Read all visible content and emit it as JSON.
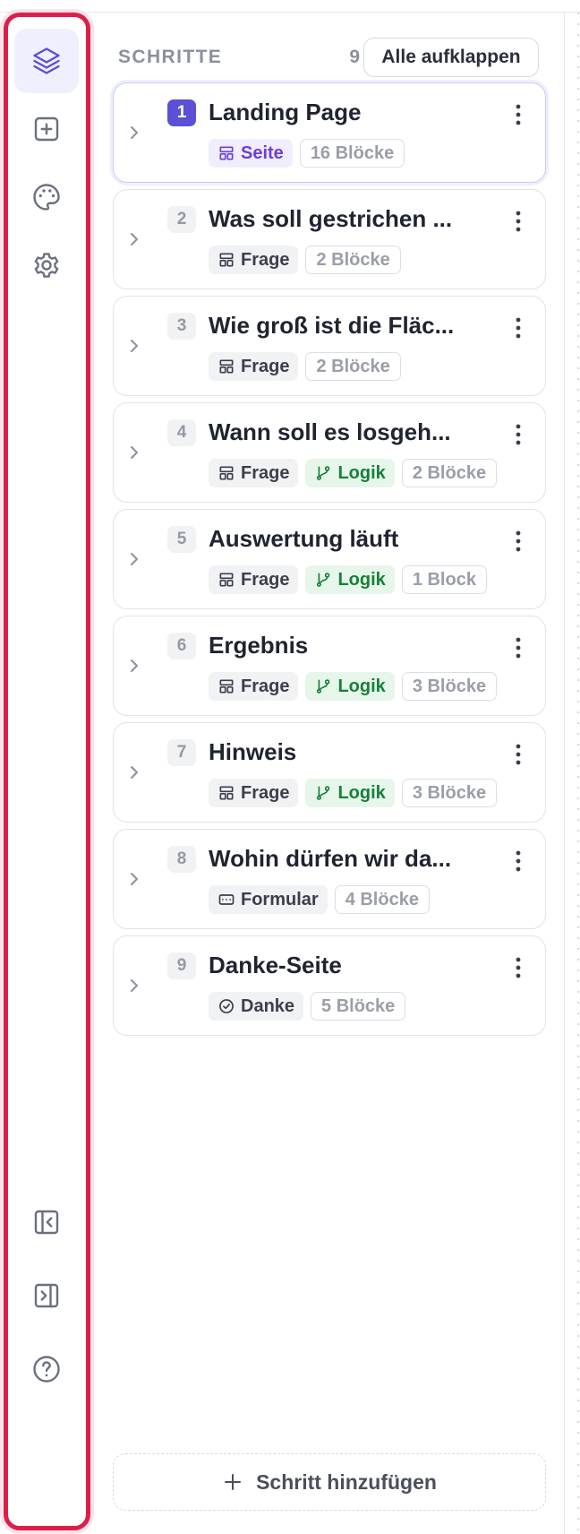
{
  "header": {
    "title": "SCHRITTE",
    "count": "9",
    "expand_all": "Alle aufklappen"
  },
  "rail": {
    "top": [
      {
        "icon": "layers-icon",
        "active": true
      },
      {
        "icon": "add-square-icon",
        "active": false
      },
      {
        "icon": "palette-icon",
        "active": false
      },
      {
        "icon": "gear-icon",
        "active": false
      }
    ],
    "bottom": [
      {
        "icon": "collapse-left-panel-icon"
      },
      {
        "icon": "expand-right-panel-icon"
      },
      {
        "icon": "help-icon"
      }
    ]
  },
  "steps": [
    {
      "num": "1",
      "title": "Landing Page",
      "type": "Seite",
      "type_icon": "layout-icon",
      "logic": null,
      "blocks": "16 Blöcke",
      "selected": true
    },
    {
      "num": "2",
      "title": "Was soll gestrichen ...",
      "type": "Frage",
      "type_icon": "layout-icon",
      "logic": null,
      "blocks": "2 Blöcke",
      "selected": false
    },
    {
      "num": "3",
      "title": "Wie groß ist die Fläc...",
      "type": "Frage",
      "type_icon": "layout-icon",
      "logic": null,
      "blocks": "2 Blöcke",
      "selected": false
    },
    {
      "num": "4",
      "title": "Wann soll es losgeh...",
      "type": "Frage",
      "type_icon": "layout-icon",
      "logic": "Logik",
      "blocks": "2 Blöcke",
      "selected": false
    },
    {
      "num": "5",
      "title": "Auswertung läuft",
      "type": "Frage",
      "type_icon": "layout-icon",
      "logic": "Logik",
      "blocks": "1 Block",
      "selected": false
    },
    {
      "num": "6",
      "title": "Ergebnis",
      "type": "Frage",
      "type_icon": "layout-icon",
      "logic": "Logik",
      "blocks": "3 Blöcke",
      "selected": false
    },
    {
      "num": "7",
      "title": "Hinweis",
      "type": "Frage",
      "type_icon": "layout-icon",
      "logic": "Logik",
      "blocks": "3 Blöcke",
      "selected": false
    },
    {
      "num": "8",
      "title": "Wohin dürfen wir da...",
      "type": "Formular",
      "type_icon": "form-icon",
      "logic": null,
      "blocks": "4 Blöcke",
      "selected": false
    },
    {
      "num": "9",
      "title": "Danke-Seite",
      "type": "Danke",
      "type_icon": "check-circle-icon",
      "logic": null,
      "blocks": "5 Blöcke",
      "selected": false
    }
  ],
  "add_step": {
    "label": "Schritt hinzufügen"
  },
  "colors": {
    "accent": "#5b50d6",
    "highlight_frame": "#dc1f48",
    "logic_green": "#18803a"
  }
}
